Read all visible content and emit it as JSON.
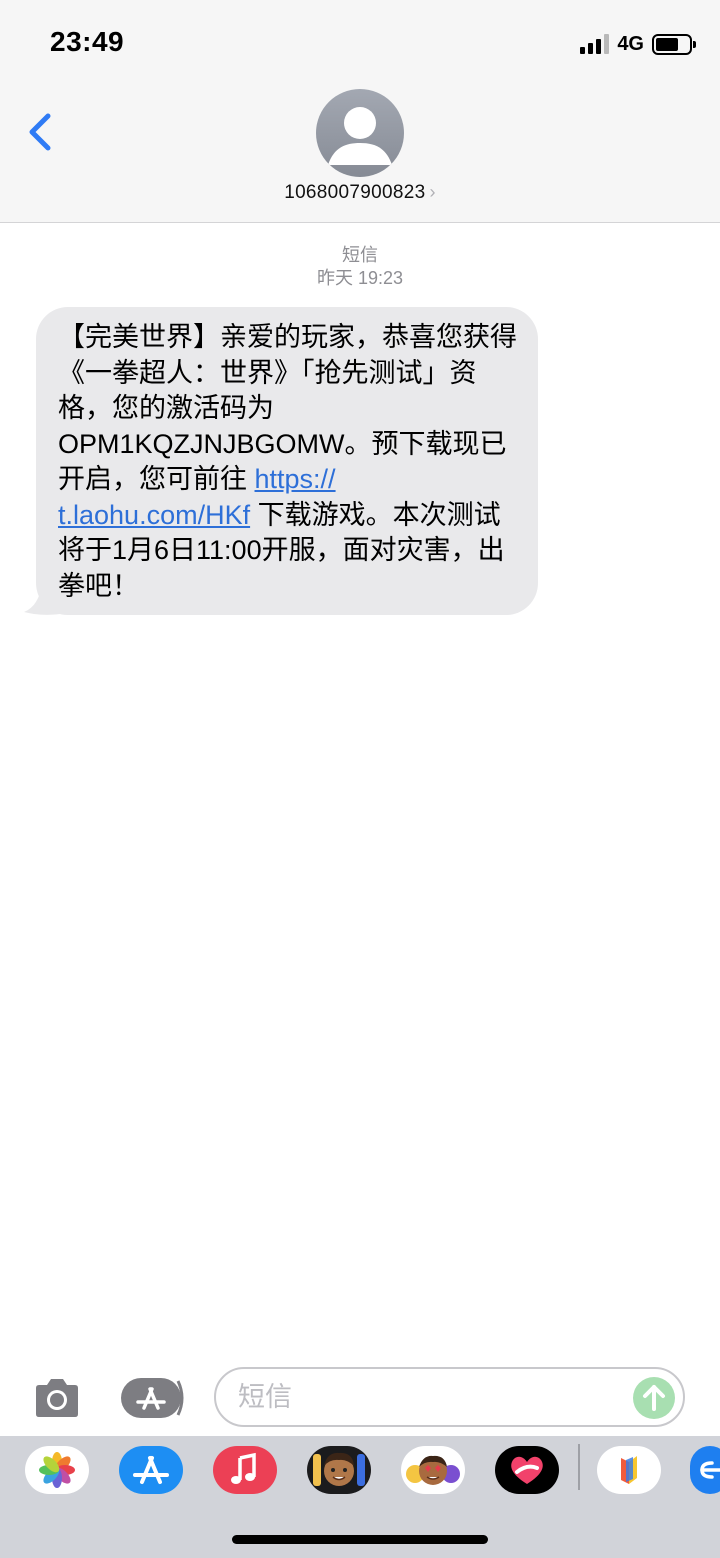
{
  "status": {
    "time": "23:49",
    "network": "4G",
    "battery_level": 0.68,
    "signal_bars": 3,
    "signal_bars_total": 4
  },
  "header": {
    "back_icon": "chevron-left-icon",
    "contact": "1068007900823",
    "contact_chevron": "›"
  },
  "meta": {
    "service": "短信",
    "timestamp": "昨天 19:23"
  },
  "message": {
    "before_link": "【完美世界】亲爱的玩家，恭喜您获得《一拳超人：世界》「抢先测试」资格，您的激活码为OPM1KQZJNJBGOMW。预下载现已开启，您可前往 ",
    "link_line1": "https://",
    "link_line2": "t.laohu.com/HKf",
    "after_link": " 下载游戏。本次测试将于1月6日11:00开服，面对灾害，出拳吧！"
  },
  "input": {
    "placeholder": "短信",
    "value": ""
  },
  "apps": [
    "photos-icon",
    "app-store-icon",
    "music-icon",
    "memoji-icon",
    "memoji-stickers-icon",
    "digital-touch-icon",
    "third-party-app-icon",
    "search-app-icon"
  ],
  "colors": {
    "link": "#2d6fd8",
    "back": "#2f7bf5",
    "bubble": "#e9e9eb",
    "send": "#a8dfb1"
  }
}
